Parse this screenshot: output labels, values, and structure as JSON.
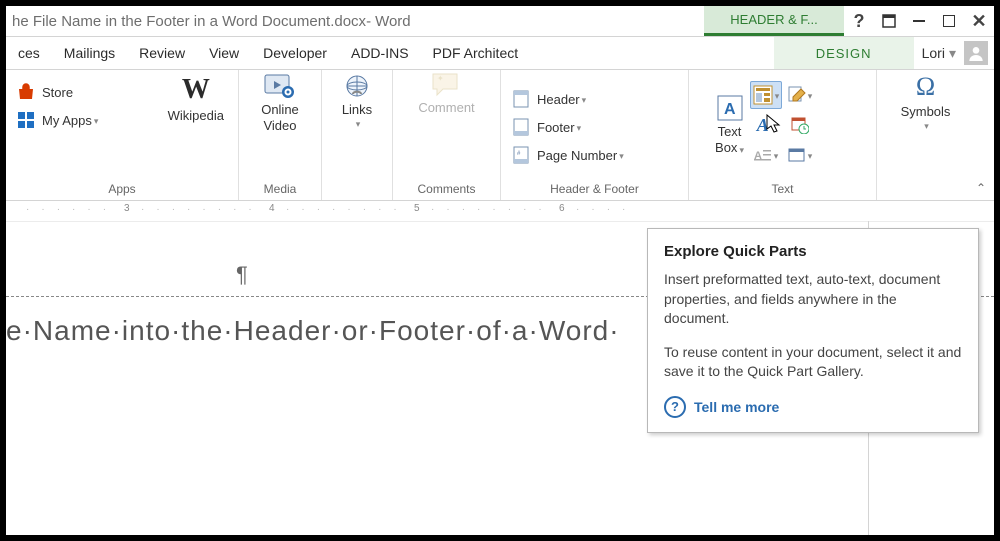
{
  "titlebar": {
    "title": "he File Name in the Footer in a Word Document.docx",
    "separator": " - ",
    "app": "Word",
    "context_tab": "HEADER & F...",
    "help_glyph": "?"
  },
  "tabs": [
    "ces",
    "Mailings",
    "Review",
    "View",
    "Developer",
    "ADD-INS",
    "PDF Architect"
  ],
  "design_tab": "DESIGN",
  "user": {
    "name": "Lori",
    "dd": "▾"
  },
  "ribbon": {
    "apps": {
      "label": "Apps",
      "store": "Store",
      "myapps": "My Apps",
      "dd": "▾",
      "wikipedia": "Wikipedia"
    },
    "media": {
      "label": "Media",
      "item": "Online\nVideo"
    },
    "links": {
      "label": "",
      "item": "Links",
      "dd": "▾"
    },
    "comments": {
      "label": "Comments",
      "item": "Comment"
    },
    "headerfooter": {
      "label": "Header & Footer",
      "header": "Header",
      "footer": "Footer",
      "pagenum": "Page Number",
      "dd": "▾"
    },
    "text": {
      "label": "Text",
      "textbox": "Text\nBox",
      "dd": "▾",
      "collapse": "⌃"
    },
    "symbols": {
      "label": "",
      "item": "Symbols",
      "dd": "▾"
    }
  },
  "ruler": {
    "n3": "3",
    "n4": "4",
    "n5": "5",
    "n6": "6"
  },
  "doc": {
    "pilcrow": "¶",
    "line": "e·Name·into·the·Header·or·Footer·of·a·Word·"
  },
  "tooltip": {
    "title": "Explore Quick Parts",
    "p1": "Insert preformatted text, auto-text, document properties, and fields anywhere in the document.",
    "p2": "To reuse content in your document, select it and save it to the Quick Part Gallery.",
    "more": "Tell me more"
  }
}
